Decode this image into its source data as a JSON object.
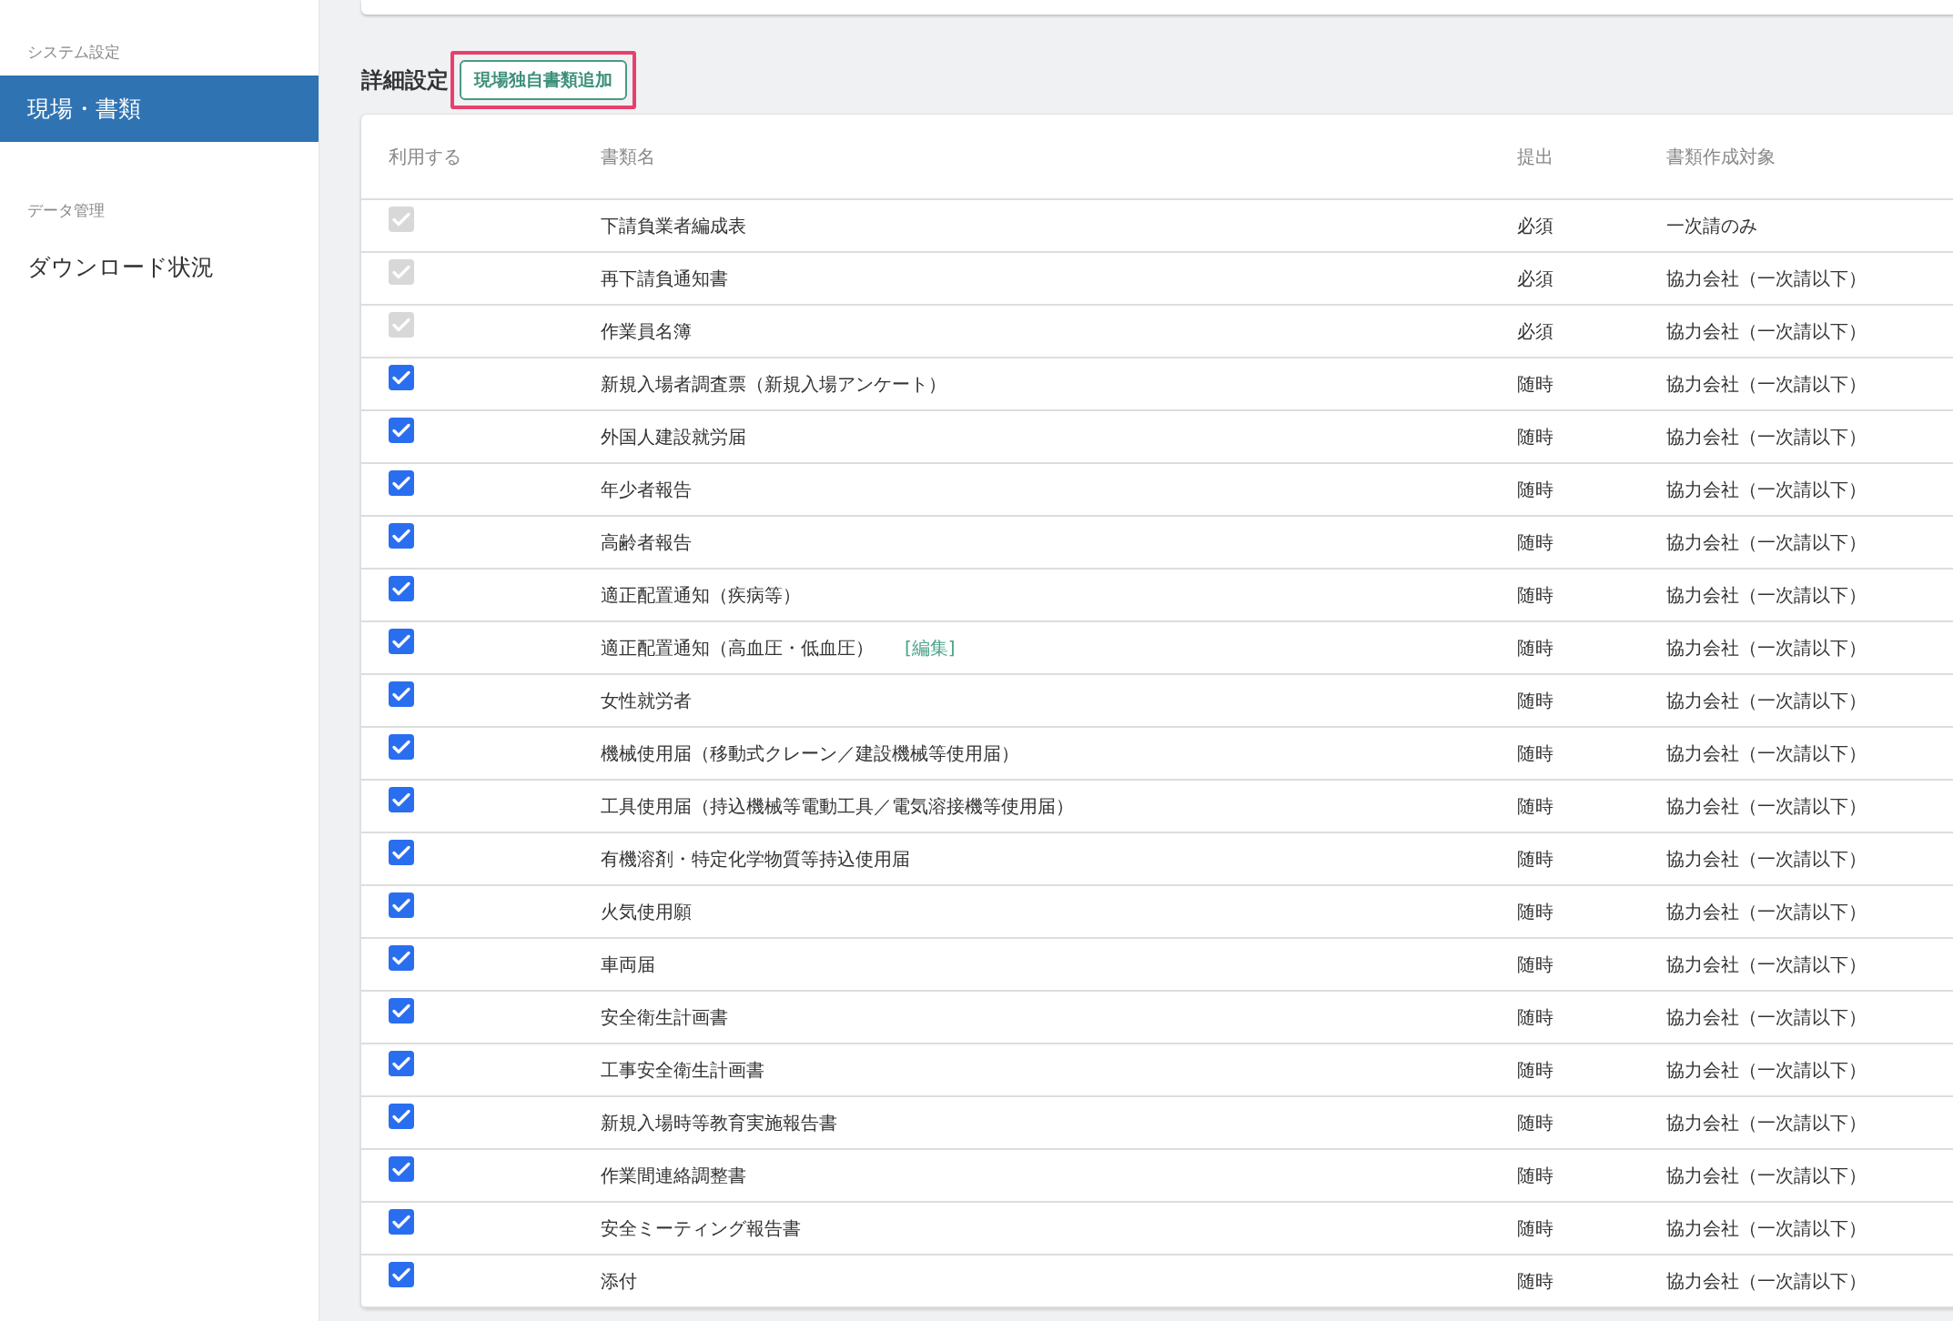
{
  "sidebar": {
    "sections": [
      {
        "heading": "システム設定",
        "items": [
          {
            "label": "現場・書類",
            "selected": true
          }
        ]
      },
      {
        "heading": "データ管理",
        "items": [
          {
            "label": "ダウンロード状況",
            "selected": false
          }
        ]
      }
    ]
  },
  "section": {
    "title": "詳細設定",
    "add_button": "現場独自書類追加",
    "highlighted": true
  },
  "table": {
    "columns": [
      "利用する",
      "書類名",
      "提出",
      "書類作成対象"
    ],
    "rows": [
      {
        "checked": true,
        "disabled": true,
        "name": "下請負業者編成表",
        "submission": "必須",
        "target": "一次請のみ"
      },
      {
        "checked": true,
        "disabled": true,
        "name": "再下請負通知書",
        "submission": "必須",
        "target": "協力会社（一次請以下）"
      },
      {
        "checked": true,
        "disabled": true,
        "name": "作業員名簿",
        "submission": "必須",
        "target": "協力会社（一次請以下）"
      },
      {
        "checked": true,
        "disabled": false,
        "name": "新規入場者調査票（新規入場アンケート）",
        "submission": "随時",
        "target": "協力会社（一次請以下）"
      },
      {
        "checked": true,
        "disabled": false,
        "name": "外国人建設就労届",
        "submission": "随時",
        "target": "協力会社（一次請以下）"
      },
      {
        "checked": true,
        "disabled": false,
        "name": "年少者報告",
        "submission": "随時",
        "target": "協力会社（一次請以下）"
      },
      {
        "checked": true,
        "disabled": false,
        "name": "高齢者報告",
        "submission": "随時",
        "target": "協力会社（一次請以下）"
      },
      {
        "checked": true,
        "disabled": false,
        "name": "適正配置通知（疾病等）",
        "submission": "随時",
        "target": "協力会社（一次請以下）"
      },
      {
        "checked": true,
        "disabled": false,
        "name": "適正配置通知（高血圧・低血圧）",
        "edit_link": "[編集]",
        "submission": "随時",
        "target": "協力会社（一次請以下）"
      },
      {
        "checked": true,
        "disabled": false,
        "name": "女性就労者",
        "submission": "随時",
        "target": "協力会社（一次請以下）"
      },
      {
        "checked": true,
        "disabled": false,
        "name": "機械使用届（移動式クレーン／建設機械等使用届）",
        "submission": "随時",
        "target": "協力会社（一次請以下）"
      },
      {
        "checked": true,
        "disabled": false,
        "name": "工具使用届（持込機械等電動工具／電気溶接機等使用届）",
        "submission": "随時",
        "target": "協力会社（一次請以下）"
      },
      {
        "checked": true,
        "disabled": false,
        "name": "有機溶剤・特定化学物質等持込使用届",
        "submission": "随時",
        "target": "協力会社（一次請以下）"
      },
      {
        "checked": true,
        "disabled": false,
        "name": "火気使用願",
        "submission": "随時",
        "target": "協力会社（一次請以下）"
      },
      {
        "checked": true,
        "disabled": false,
        "name": "車両届",
        "submission": "随時",
        "target": "協力会社（一次請以下）"
      },
      {
        "checked": true,
        "disabled": false,
        "name": "安全衛生計画書",
        "submission": "随時",
        "target": "協力会社（一次請以下）"
      },
      {
        "checked": true,
        "disabled": false,
        "name": "工事安全衛生計画書",
        "submission": "随時",
        "target": "協力会社（一次請以下）"
      },
      {
        "checked": true,
        "disabled": false,
        "name": "新規入場時等教育実施報告書",
        "submission": "随時",
        "target": "協力会社（一次請以下）"
      },
      {
        "checked": true,
        "disabled": false,
        "name": "作業間連絡調整書",
        "submission": "随時",
        "target": "協力会社（一次請以下）"
      },
      {
        "checked": true,
        "disabled": false,
        "name": "安全ミーティング報告書",
        "submission": "随時",
        "target": "協力会社（一次請以下）"
      },
      {
        "checked": true,
        "disabled": false,
        "name": "添付",
        "submission": "随時",
        "target": "協力会社（一次請以下）"
      }
    ]
  }
}
